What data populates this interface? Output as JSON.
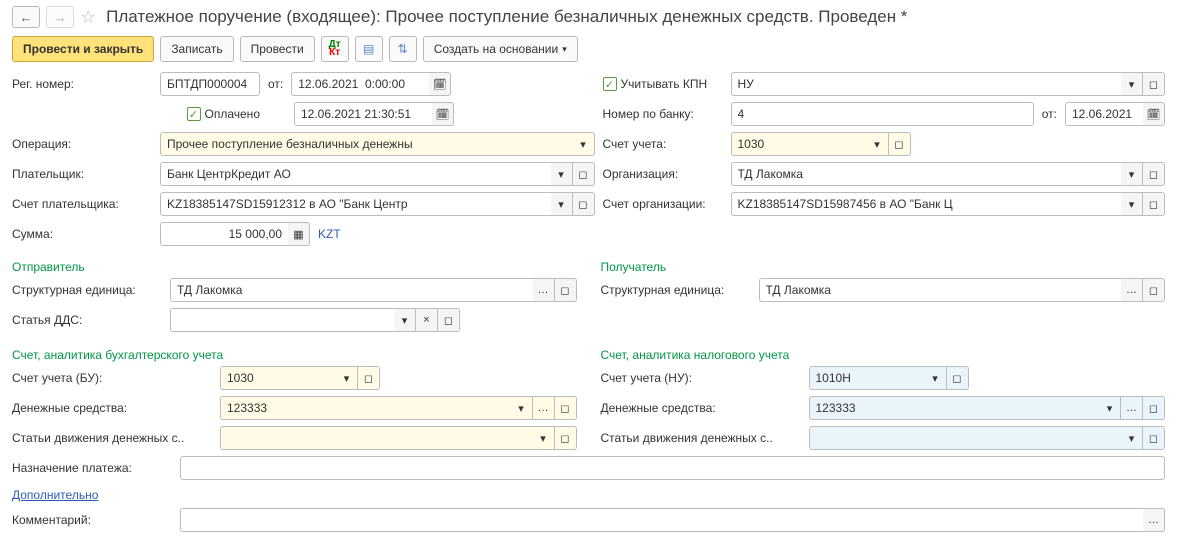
{
  "header": {
    "title": "Платежное поручение (входящее): Прочее поступление безналичных денежных средств. Проведен *"
  },
  "toolbar": {
    "post_close": "Провести и закрыть",
    "save": "Записать",
    "post": "Провести",
    "create_based": "Создать на основании"
  },
  "form": {
    "reg_number_label": "Рег. номер:",
    "reg_number_value": "БПТДП000004",
    "from_label": "от:",
    "date1": "12.06.2021  0:00:00",
    "consider_kpn_label": "Учитывать КПН",
    "nu_value": "НУ",
    "paid_label": "Оплачено",
    "date2": "12.06.2021 21:30:51",
    "bank_no_label": "Номер по банку:",
    "bank_no_value": "4",
    "bank_from_label": "от:",
    "bank_date": "12.06.2021",
    "operation_label": "Операция:",
    "operation_value": "Прочее поступление безналичных денежны",
    "account_label": "Счет учета:",
    "account_value": "1030",
    "payer_label": "Плательщик:",
    "payer_value": "Банк ЦентрКредит АО",
    "org_label": "Организация:",
    "org_value": "ТД Лакомка",
    "payer_acct_label": "Счет плательщика:",
    "payer_acct_value": "KZ18385147SD15912312 в АО \"Банк Центр",
    "org_acct_label": "Счет организации:",
    "org_acct_value": "KZ18385147SD15987456 в АО \"Банк Ц",
    "sum_label": "Сумма:",
    "sum_value": "15 000,00",
    "currency": "KZT"
  },
  "parties": {
    "sender_header": "Отправитель",
    "recipient_header": "Получатель",
    "struct_unit_label": "Структурная единица:",
    "struct_unit_value_sender": "ТД Лакомка",
    "struct_unit_value_recipient": "ТД Лакомка",
    "dds_label": "Статья ДДС:",
    "dds_value": ""
  },
  "accounts": {
    "bu_header": "Счет, аналитика бухгалтерского учета",
    "nu_header": "Счет, аналитика налогового учета",
    "account_bu_label": "Счет учета (БУ):",
    "account_bu_value": "1030",
    "account_nu_label": "Счет учета (НУ):",
    "account_nu_value": "1010Н",
    "cash_label": "Денежные средства:",
    "cash_value_left": "123333",
    "cash_value_right": "123333",
    "flow_label": "Статьи движения денежных с..",
    "flow_value_left": "",
    "flow_value_right": ""
  },
  "bottom": {
    "purpose_label": "Назначение платежа:",
    "purpose_value": "",
    "additional_label": "Дополнительно",
    "comment_label": "Комментарий:",
    "comment_value": ""
  }
}
